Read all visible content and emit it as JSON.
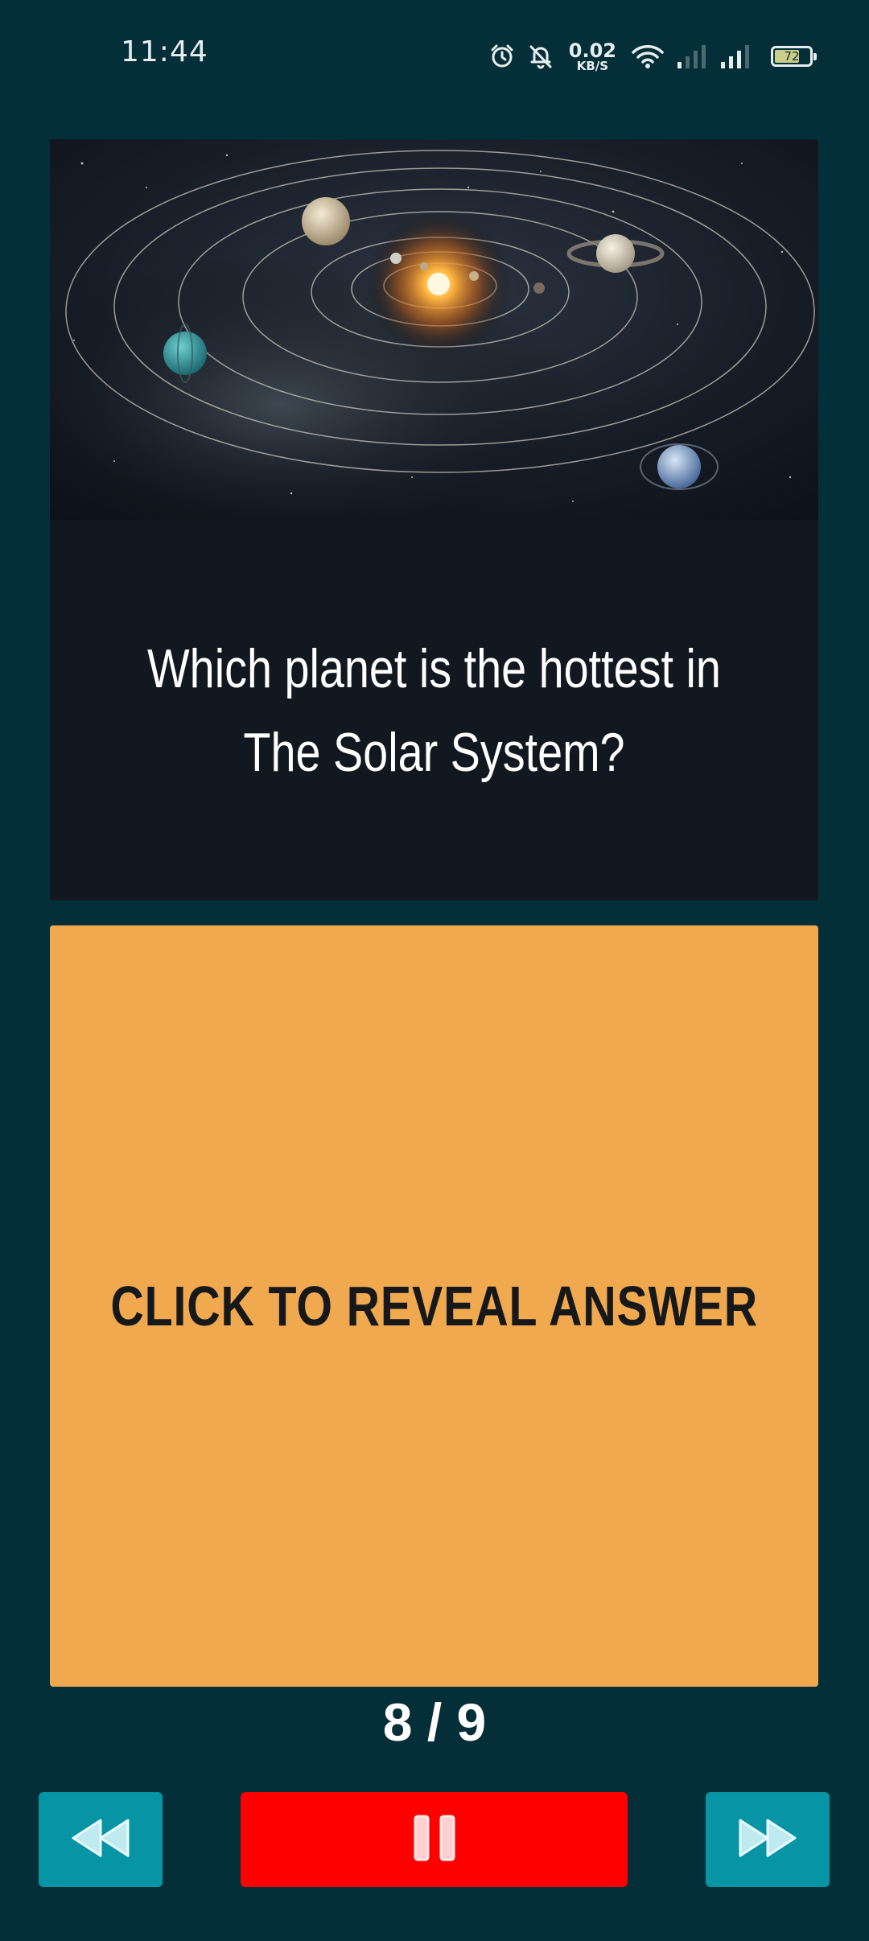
{
  "status_bar": {
    "time": "11:44",
    "net_speed_value": "0.02",
    "net_speed_unit": "KB/S",
    "battery_level": "72",
    "battery_fraction": 0.72,
    "icons": [
      "alarm-icon",
      "bell-off-icon",
      "wifi-icon",
      "signal-weak-icon",
      "signal-icon",
      "battery-icon"
    ]
  },
  "question": {
    "image_subject": "solar-system-image",
    "text": "Which planet is the hottest in The Solar System?"
  },
  "answer": {
    "label": "CLICK TO REVEAL ANSWER"
  },
  "progress": {
    "current": 8,
    "total": 9,
    "label": "8 / 9"
  },
  "controls": {
    "prev_icon": "rewind-icon",
    "pause_icon": "pause-icon",
    "next_icon": "fast-forward-icon"
  },
  "colors": {
    "background": "#052f38",
    "question_card": "#11181f",
    "answer_card": "#f0a94e",
    "nav_button": "#0795a6",
    "pause_button": "#ff0000"
  }
}
